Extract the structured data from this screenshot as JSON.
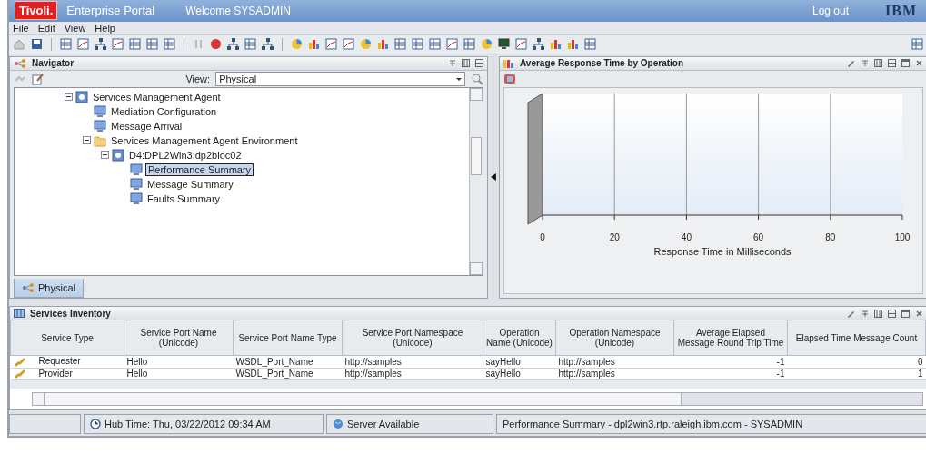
{
  "window": {
    "logo": "Tivoli.",
    "title": "Enterprise Portal",
    "welcome": "Welcome SYSADMIN",
    "logout": "Log out",
    "brand": "IBM"
  },
  "menu": [
    "File",
    "Edit",
    "View",
    "Help"
  ],
  "navigator": {
    "title": "Navigator",
    "view_label": "View:",
    "view_value": "Physical",
    "tree": [
      {
        "label": "Services Management Agent",
        "kind": "agent",
        "expanded": true,
        "selected": false,
        "children": [
          {
            "label": "Mediation Configuration",
            "kind": "workspace",
            "selected": false
          },
          {
            "label": "Message Arrival",
            "kind": "workspace",
            "selected": false
          },
          {
            "label": "Services Management Agent Environment",
            "kind": "folder",
            "expanded": true,
            "selected": false,
            "children": [
              {
                "label": "D4:DPL2Win3:dp2bloc02",
                "kind": "agent",
                "expanded": true,
                "selected": false,
                "children": [
                  {
                    "label": "Performance Summary",
                    "kind": "workspace",
                    "selected": true
                  },
                  {
                    "label": "Message Summary",
                    "kind": "workspace",
                    "selected": false
                  },
                  {
                    "label": "Faults Summary",
                    "kind": "workspace",
                    "selected": false
                  }
                ]
              }
            ]
          }
        ]
      }
    ],
    "tabs": [
      {
        "label": "Physical",
        "selected": true
      }
    ]
  },
  "chart_panel": {
    "title": "Average Response Time by Operation",
    "axis_labels": [
      "0",
      "20",
      "40",
      "60",
      "80",
      "100"
    ],
    "axis_title": "Response Time in Milliseconds"
  },
  "inventory": {
    "title": "Services Inventory",
    "columns": [
      "Service Type",
      "Service Port Name (Unicode)",
      "Service Port Name Type",
      "Service Port Namespace (Unicode)",
      "Operation Name (Unicode)",
      "Operation Namespace (Unicode)",
      "Average Elapsed Message Round Trip Time",
      "Elapsed Time Message Count"
    ],
    "rows": [
      {
        "cells": [
          "Requester",
          "Hello",
          "WSDL_Port_Name",
          "http://samples",
          "sayHello",
          "http://samples",
          "-1",
          "0"
        ]
      },
      {
        "cells": [
          "Provider",
          "Hello",
          "WSDL_Port_Name",
          "http://samples",
          "sayHello",
          "http://samples",
          "-1",
          "1"
        ]
      }
    ]
  },
  "status_bar": [
    "Hub Time: Thu, 03/22/2012 09:34 AM",
    "Server Available",
    "Performance Summary - dpl2win3.rtp.raleigh.ibm.com - SYSADMIN"
  ]
}
